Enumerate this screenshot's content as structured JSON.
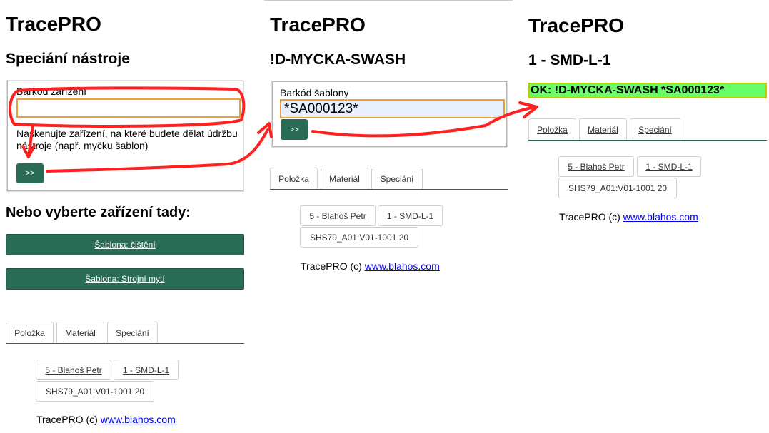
{
  "app_title": "TracePRO",
  "colors": {
    "primary": "#2a6b56",
    "ok_background": "#66ff66",
    "input_border": "#e6a23c",
    "annotation": "#ff2020"
  },
  "screens": [
    {
      "page_title": "Speciání nástroje",
      "field_label": "Barkód zařízení",
      "input_value": "",
      "hint": "Naskenujte zařízení, na které budete dělat údržbu nástroje (např. myčku šablon)",
      "submit_label": ">>",
      "choose_heading": "Nebo vyberte zařízení tady:",
      "device_buttons": [
        "Šablona: čištění",
        "Šablona: Strojní mytí"
      ]
    },
    {
      "page_title": "!D-MYCKA-SWASH",
      "field_label": "Barkód šablony",
      "input_value": "*SA000123*",
      "submit_label": ">>"
    },
    {
      "page_title": "1 - SMD-L-1",
      "ok_message": "OK: !D-MYCKA-SWASH *SA000123*"
    }
  ],
  "tabs": [
    "Položka",
    "Materiál",
    "Speciání"
  ],
  "context": {
    "user": "5 - Blahoš Petr",
    "line": "1 - SMD-L-1",
    "station": "SHS79_A01:V01-1001 20"
  },
  "footer": {
    "text": "TracePRO (c) ",
    "link": "www.blahos.com"
  },
  "annotation_icons": [
    "highlight-ellipse-icon",
    "arrow-icon"
  ]
}
